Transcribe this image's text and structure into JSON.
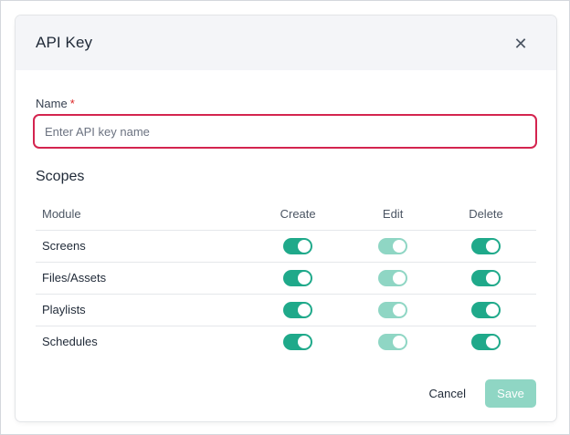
{
  "modal": {
    "title": "API Key",
    "close_icon": "close-icon"
  },
  "form": {
    "name_label": "Name",
    "required_mark": "*",
    "name_placeholder": "Enter API key name",
    "name_value": ""
  },
  "scopes": {
    "title": "Scopes",
    "columns": [
      "Module",
      "Create",
      "Edit",
      "Delete"
    ],
    "rows": [
      {
        "module": "Screens",
        "create": true,
        "edit": true,
        "delete": true
      },
      {
        "module": "Files/Assets",
        "create": true,
        "edit": true,
        "delete": true
      },
      {
        "module": "Playlists",
        "create": true,
        "edit": true,
        "delete": true
      },
      {
        "module": "Schedules",
        "create": true,
        "edit": true,
        "delete": true
      }
    ],
    "edit_column_disabled": true
  },
  "footer": {
    "cancel_label": "Cancel",
    "save_label": "Save",
    "save_disabled": true
  },
  "colors": {
    "accent": "#1fa98a",
    "accent_disabled": "#8fd6c4",
    "input_border_error": "#d4244f",
    "required": "#dc2626"
  }
}
